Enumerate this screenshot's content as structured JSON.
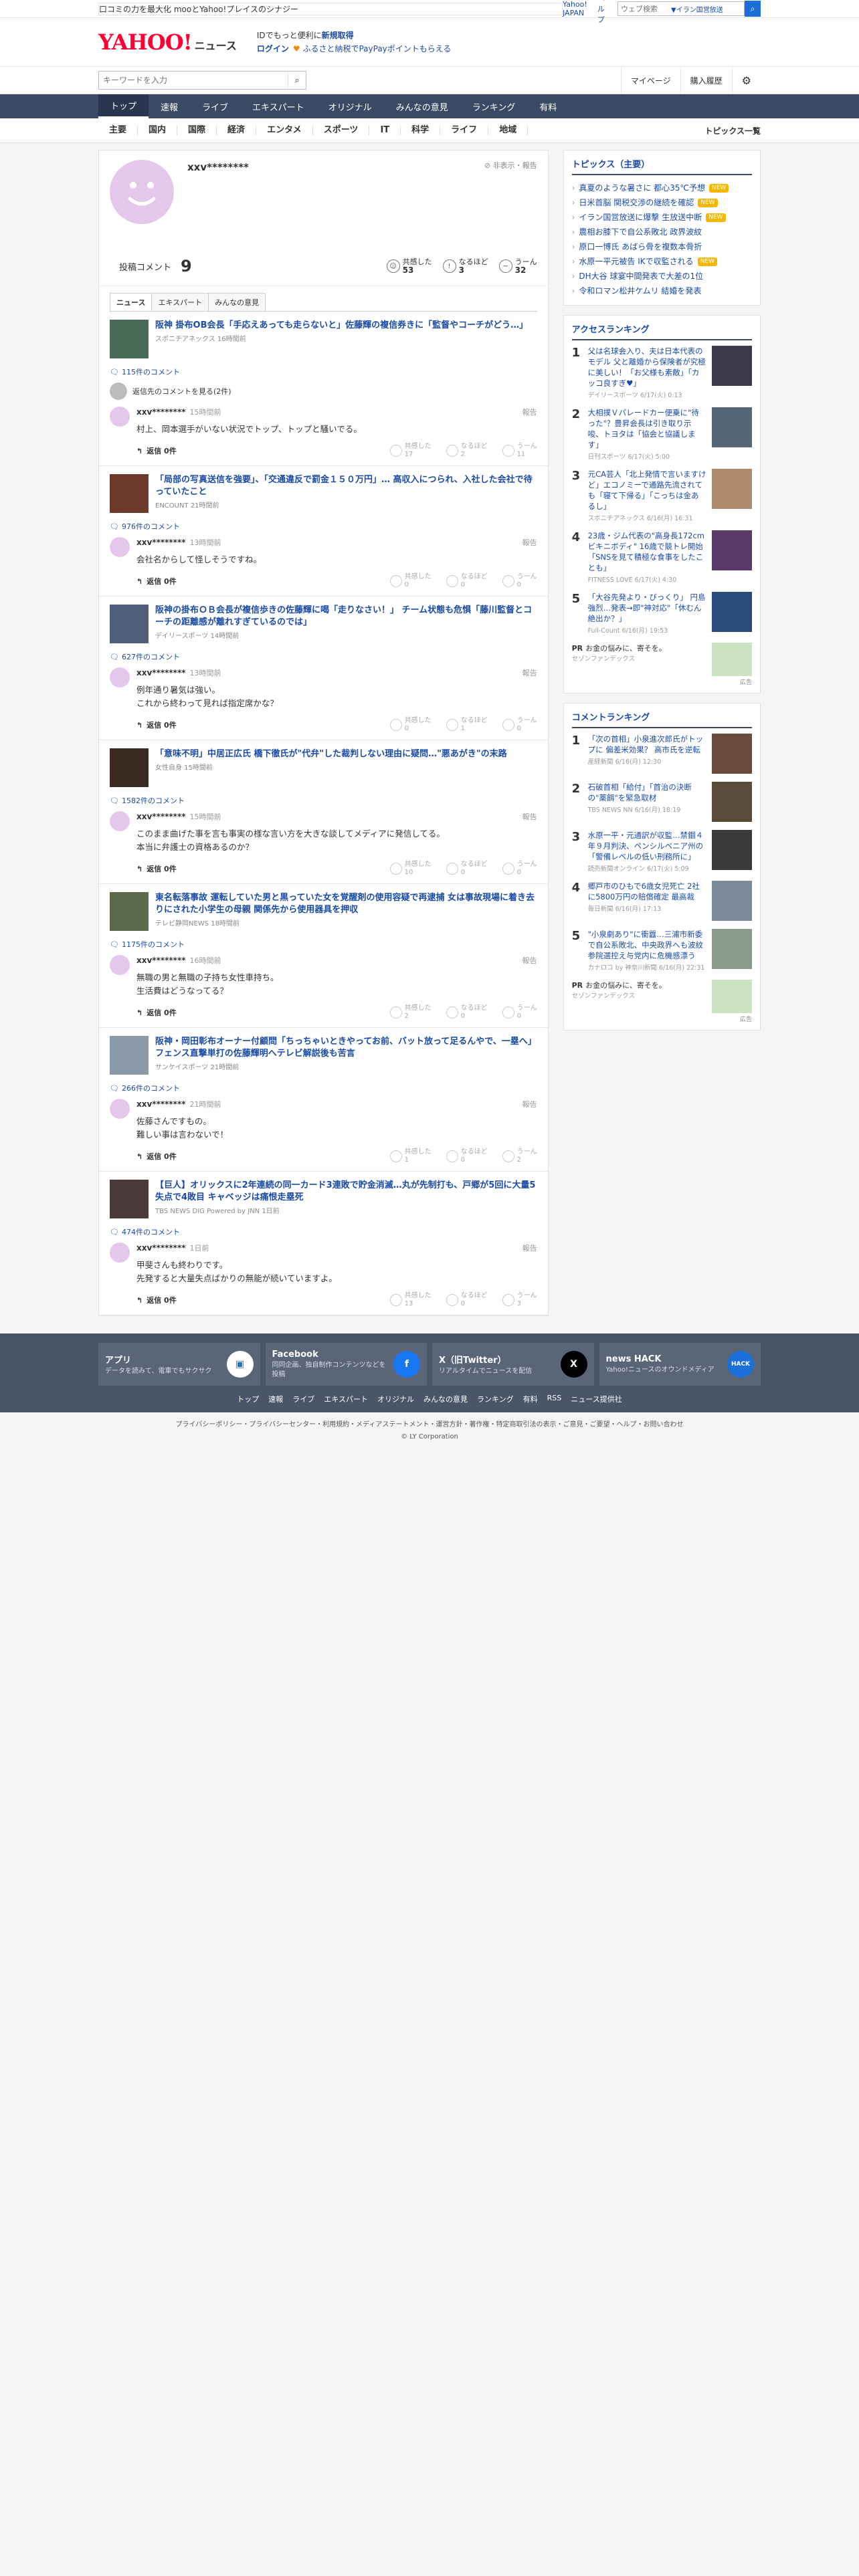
{
  "promo": {
    "text": "口コミの力を最大化 mooとYahoo!プレイスのシナジー",
    "yahoo_japan": "Yahoo! JAPAN",
    "help": "ヘルプ",
    "search_placeholder": "ウェブ検索",
    "trending": "▼イラン国営放送"
  },
  "brand": {
    "logo_text": "YAHOO! JAPAN",
    "service": "ニュース",
    "line1_pre": "IDでもっと便利に",
    "line1_link": "新規取得",
    "login": "ログイン",
    "furusato": "ふるさと納税でPayPayポイントもらえる"
  },
  "search": {
    "placeholder": "キーワードを入力",
    "mypage": "マイページ",
    "history": "購入履歴"
  },
  "nav": [
    "トップ",
    "速報",
    "ライブ",
    "エキスパート",
    "オリジナル",
    "みんなの意見",
    "ランキング",
    "有料"
  ],
  "subnav": [
    "主要",
    "国内",
    "国際",
    "経済",
    "エンタメ",
    "スポーツ",
    "IT",
    "科学",
    "ライフ",
    "地域"
  ],
  "subnav_more": "トピックス一覧",
  "profile": {
    "username": "xxv********",
    "hidden_report": "非表示・報告",
    "posts_label": "投稿コメント",
    "posts_count": "9",
    "agree_label": "共感した",
    "agree_count": "53",
    "insight_label": "なるほど",
    "insight_count": "3",
    "hmm_label": "うーん",
    "hmm_count": "32"
  },
  "tabs": [
    "ニュース",
    "エキスパート",
    "みんなの意見"
  ],
  "reactions_labels": {
    "agree": "共感した",
    "insight": "なるほど",
    "hmm": "うーん"
  },
  "reply_label": "返信 0件",
  "report_label": "報告",
  "threads": [
    {
      "title": "阪神 掛布OB会長「手応えあっても走らないと」佐藤輝の複信券きに「監督やコーチがどう…」",
      "meta": "スポニチアネックス 16時間前",
      "ccount": "115件のコメント",
      "parent": "返信先のコメントを見る(2件)",
      "user": "xxv********",
      "time": "15時間前",
      "text": "村上、岡本選手がいない状況でトップ、トップと騒いでる。",
      "agree": "17",
      "insight": "2",
      "hmm": "11",
      "thumb": "#4a6a58"
    },
    {
      "title": "「局部の写真送信を強要」、「交通違反で罰金１５０万円」… 高収入につられ、入社した会社で待っていたこと",
      "meta": "ENCOUNT 21時間前",
      "ccount": "976件のコメント",
      "parent": "",
      "user": "xxv********",
      "time": "13時間前",
      "text": "会社名からして怪しそうですね。",
      "agree": "0",
      "insight": "0",
      "hmm": "0",
      "thumb": "#6b3a2a"
    },
    {
      "title": "阪神の掛布ＯＢ会長が複信歩きの佐藤輝に喝「走りなさい！」 チーム状態も危惧「藤川監督とコーチの距離感が離れすぎているのでは」",
      "meta": "デイリースポーツ 14時間前",
      "ccount": "627件のコメント",
      "parent": "",
      "user": "xxv********",
      "time": "13時間前",
      "text": "例年通り暑気は強い。\nこれから終わって見れば指定席かな？",
      "agree": "0",
      "insight": "1",
      "hmm": "0",
      "thumb": "#4f5f7a"
    },
    {
      "title": "「意味不明」中居正広氏 橋下徹氏が\"代弁\"した裁判しない理由に疑問…\"悪あがき\"の末路",
      "meta": "女性自身 15時間前",
      "ccount": "1582件のコメント",
      "parent": "",
      "user": "xxv********",
      "time": "15時間前",
      "text": "このまま曲げた事を言も事実の様な言い方を大きな談してメディアに発信してる。\n本当に弁護士の資格あるのか？",
      "agree": "10",
      "insight": "0",
      "hmm": "0",
      "thumb": "#3a2a22"
    },
    {
      "title": "東名転落事故 運転していた男と黒っていた女を覚醒剤の使用容疑で再逮捕 女は事故現場に着き去りにされた小学生の母親 関係先から使用器具を押収",
      "meta": "テレビ静岡NEWS 18時間前",
      "ccount": "1175件のコメント",
      "parent": "",
      "user": "xxv********",
      "time": "16時間前",
      "text": "無職の男と無職の子持ち女性車持ち。\n生活費はどうなってる？",
      "agree": "2",
      "insight": "0",
      "hmm": "0",
      "thumb": "#5a6a4a"
    },
    {
      "title": "阪神・岡田彰布オーナー付顧問「ちっちゃいときやってお前、バット放って足るんやで、一塁へ」 フェンス直撃単打の佐藤輝明へテレビ解説後も苦言",
      "meta": "サンケイスポーツ 21時間前",
      "ccount": "266件のコメント",
      "parent": "",
      "user": "xxv********",
      "time": "21時間前",
      "text": "佐藤さんですもの。\n難しい事は言わないで！",
      "agree": "1",
      "insight": "0",
      "hmm": "2",
      "thumb": "#8a9aa8"
    },
    {
      "title": "【巨人】オリックスに2年連続の同一カード3連敗で貯金消滅…丸が先制打も、戸郷が5回に大量5失点で4敗目 キャベッジは痛恨走塁死",
      "meta": "TBS NEWS DIG Powered by JNN 1日前",
      "ccount": "474件のコメント",
      "parent": "",
      "user": "xxv********",
      "time": "1日前",
      "text": "甲斐さんも終わりです。\n先発すると大量失点ばかりの無能が続いていますよ。",
      "agree": "13",
      "insight": "0",
      "hmm": "3",
      "thumb": "#4a3a3a"
    }
  ],
  "topics": {
    "title": "トピックス（主要）",
    "items": [
      {
        "text": "真夏のような暑さに 都心35℃予想",
        "badge": "NEW"
      },
      {
        "text": "日米首脳 関税交渉の継続を確認",
        "badge": "NEW"
      },
      {
        "text": "イラン国営放送に爆撃 生放送中断",
        "badge": "NEW"
      },
      {
        "text": "農相お膝下で自公系敗北 政界波紋",
        "badge": ""
      },
      {
        "text": "原口一博氏 あばら骨を複数本骨折",
        "badge": ""
      },
      {
        "text": "水原一平元被告 IKで収監される",
        "badge": "NEW"
      },
      {
        "text": "DH大谷 球宴中間発表で大差の1位",
        "badge": ""
      },
      {
        "text": "令和ロマン松井ケムリ 結婚を発表",
        "badge": ""
      }
    ]
  },
  "access_ranking": {
    "title": "アクセスランキング",
    "items": [
      {
        "n": "1",
        "text": "父は名球会入り、夫は日本代表のモデル 父と離婚から保険者が究極に美しい！「お父様も素敵」「カッコ良すぎ♥」",
        "meta": "デイリースポーツ 6/17(火) 0:13",
        "color": "#3a3a4a"
      },
      {
        "n": "2",
        "text": "大相撲Ｖパレードカー便乗に\"待った\"？豊昇会長は引き取り示唆、トヨタは「協会と協議します」",
        "meta": "日刊スポーツ 6/17(火) 5:00",
        "color": "#556677"
      },
      {
        "n": "3",
        "text": "元CA芸人「北上発情で言いますけど」エコノミーで通路先流されても「寝て下帰る」「こっちは金あるし」",
        "meta": "スポニチアネックス 6/16(月) 16:31",
        "color": "#b08a6a"
      },
      {
        "n": "4",
        "text": "23歳・ジム代表の\"高身長172cmビキニボディ\" 16歳で競トレ開始「SNSを見て積極な食事をしたことも」",
        "meta": "FITNESS LOVE 6/17(火) 4:30",
        "color": "#5a3a6a"
      },
      {
        "n": "5",
        "text": "「大谷先発より・びっくり」 円島強烈…発表→即\"神対応\"「休むん絶出か？」",
        "meta": "Full-Count 6/16(月) 19:53",
        "color": "#2a4a7a"
      }
    ]
  },
  "pr": {
    "tag": "PR",
    "text": "お金の悩みに、寄そを。",
    "sponsor": "セゾンファンデックス",
    "adnote": "広告"
  },
  "comment_ranking": {
    "title": "コメントランキング",
    "items": [
      {
        "n": "1",
        "text": "「次の首相」小泉進次郎氏がトップに 偏差米効果？ 高市氏を逆転",
        "meta": "産経新聞 6/16(月) 12:30",
        "color": "#6a4a3a"
      },
      {
        "n": "2",
        "text": "石破首相「給付」「首治の決断の\"薬餌\"を緊急取材",
        "meta": "TBS NEWS NN 6/16(月) 18:19",
        "color": "#5a4a3a"
      },
      {
        "n": "3",
        "text": "水原一平・元通訳が収監…禁錮４年９月判決、ペンシルベニア州の「警備レベルの低い刑務所に」",
        "meta": "読売新聞オンライン 6/17(火) 5:09",
        "color": "#3a3a3a"
      },
      {
        "n": "4",
        "text": "郷戸市のひもで6歳女児死亡 2社に5800万円の賠償確定 最高裁",
        "meta": "毎日新聞 6/16(月) 17:13",
        "color": "#7a8a9a"
      },
      {
        "n": "5",
        "text": "\"小泉劇あり\"に衝囂…三浦市新委で自公系敗北、中央政界へも波紋 参院選控え与党内に危機感漂う",
        "meta": "カナロコ by 神奈川新聞 6/16(月) 22:31",
        "color": "#8a9a8a"
      }
    ]
  },
  "footer": {
    "cards": [
      {
        "h": "アプリ",
        "d": "データを読みて、電車でもサクサク",
        "icon": "app-icon",
        "color": "#fff",
        "fg": "#1a6fd8",
        "glyph": "▣"
      },
      {
        "h": "Facebook",
        "d": "同同企画、独自制作コンテンツなどを投稿",
        "icon": "facebook-icon",
        "color": "#1877f2",
        "fg": "#fff",
        "glyph": "f"
      },
      {
        "h": "X（旧Twitter）",
        "d": "リアルタイムでニュースを配信",
        "icon": "x-icon",
        "color": "#000",
        "fg": "#fff",
        "glyph": "X"
      },
      {
        "h": "news HACK",
        "d": "Yahoo!ニュースのオウンドメディア",
        "icon": "newshack-icon",
        "color": "#1a6fd8",
        "fg": "#fff",
        "glyph": "HACK"
      }
    ],
    "links": [
      "トップ",
      "速報",
      "ライブ",
      "エキスパート",
      "オリジナル",
      "みんなの意見",
      "ランキング",
      "有料",
      "RSS",
      "ニュース提供社"
    ],
    "legal": "プライバシーポリシー・プライバシーセンター・利用規約・メディアステートメント・運営方針・著作権・特定商取引法の表示・ご意見・ご要望・ヘルプ・お問い合わせ",
    "copyright": "© LY Corporation"
  }
}
